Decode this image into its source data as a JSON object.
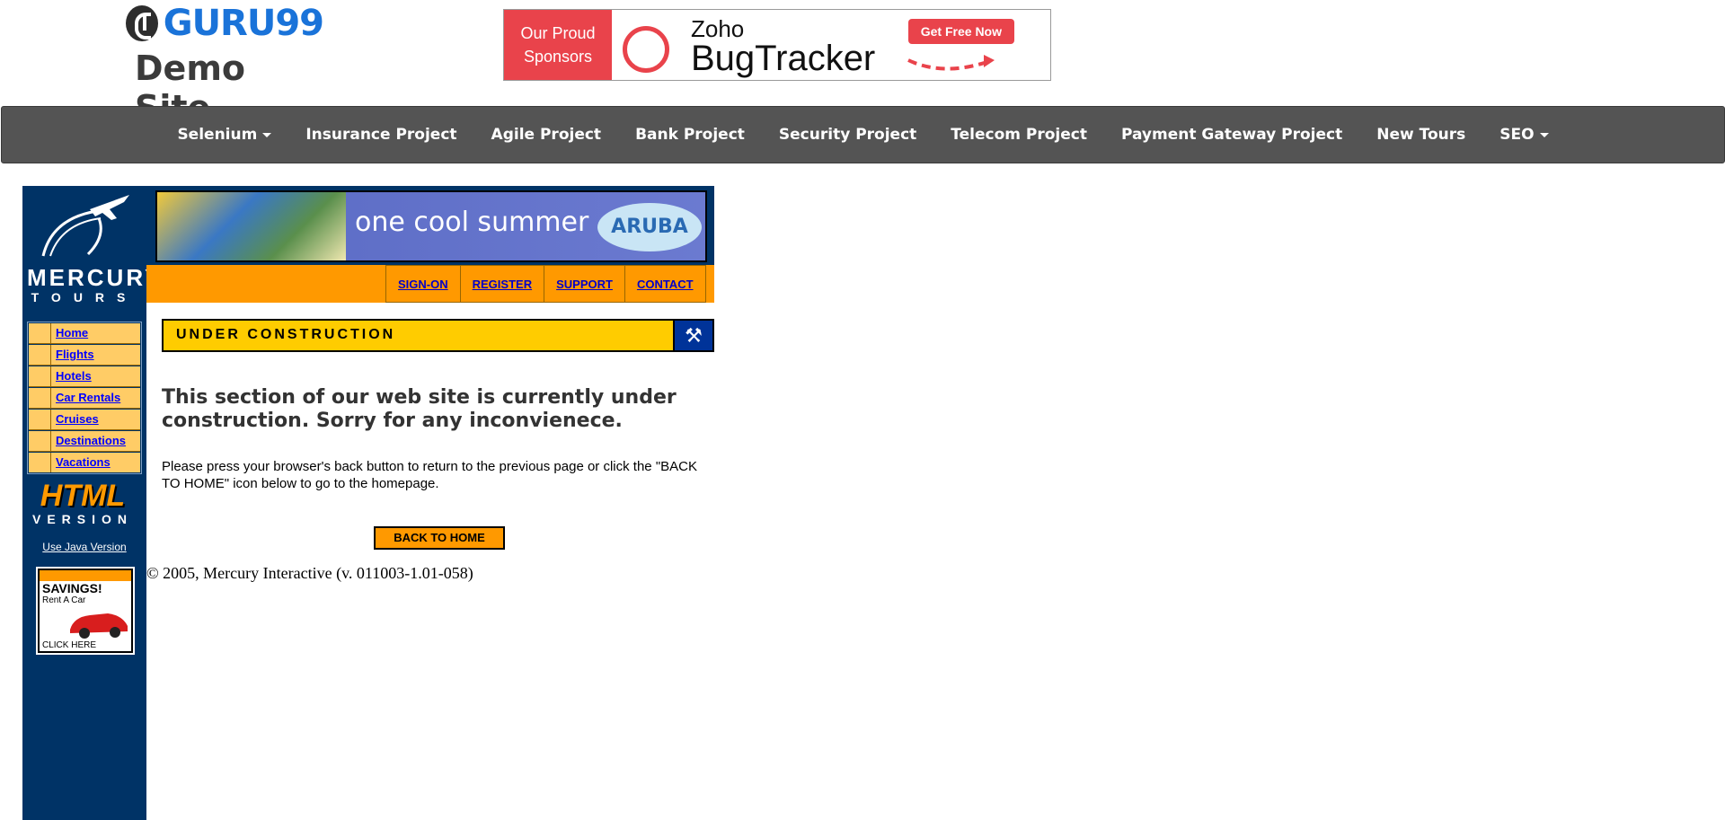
{
  "header": {
    "logo_text": "GURU99",
    "site_subtitle": "Demo Site",
    "sponsor": {
      "label_line1": "Our Proud",
      "label_line2": "Sponsors",
      "brand_top": "Zoho",
      "brand_main": "BugTracker",
      "cta": "Get Free Now"
    }
  },
  "nav": {
    "items": [
      {
        "label": "Selenium",
        "dropdown": true
      },
      {
        "label": "Insurance Project"
      },
      {
        "label": "Agile Project"
      },
      {
        "label": "Bank Project"
      },
      {
        "label": "Security Project"
      },
      {
        "label": "Telecom Project"
      },
      {
        "label": "Payment Gateway Project"
      },
      {
        "label": "New Tours"
      },
      {
        "label": "SEO",
        "dropdown": true
      }
    ]
  },
  "mercury": {
    "logo_line1": "MERCURY",
    "logo_line2": "TOURS",
    "side_menu": [
      "Home",
      "Flights",
      "Hotels",
      "Car Rentals",
      "Cruises",
      "Destinations",
      "Vacations"
    ],
    "html_version_big": "HTML",
    "html_version_small": "VERSION",
    "java_link": "Use Java Version",
    "savings": {
      "title": "SAVINGS!",
      "subtitle": "Rent A Car",
      "cta": "CLICK HERE"
    },
    "banner_text": "one cool summer",
    "banner_brand": "ARUBA",
    "top_links": [
      "SIGN-ON",
      "REGISTER",
      "SUPPORT",
      "CONTACT"
    ],
    "section_title": "UNDER CONSTRUCTION",
    "message_heading": "This section of our web site is currently under construction.   Sorry for any inconvienece.",
    "message_body": "Please press your browser's back button to return to the previous page or click the \"BACK TO HOME\" icon below to go to the homepage.",
    "back_button": "BACK TO HOME",
    "copyright": "© 2005, Mercury Interactive (v. 011003-1.01-058)"
  },
  "colors": {
    "nav_bg": "#545454",
    "brand_blue": "#1a73d9",
    "mercury_navy": "#003366",
    "mercury_orange": "#ff9900",
    "menu_yellow": "#ffcc66",
    "sponsor_red": "#e9434b"
  }
}
